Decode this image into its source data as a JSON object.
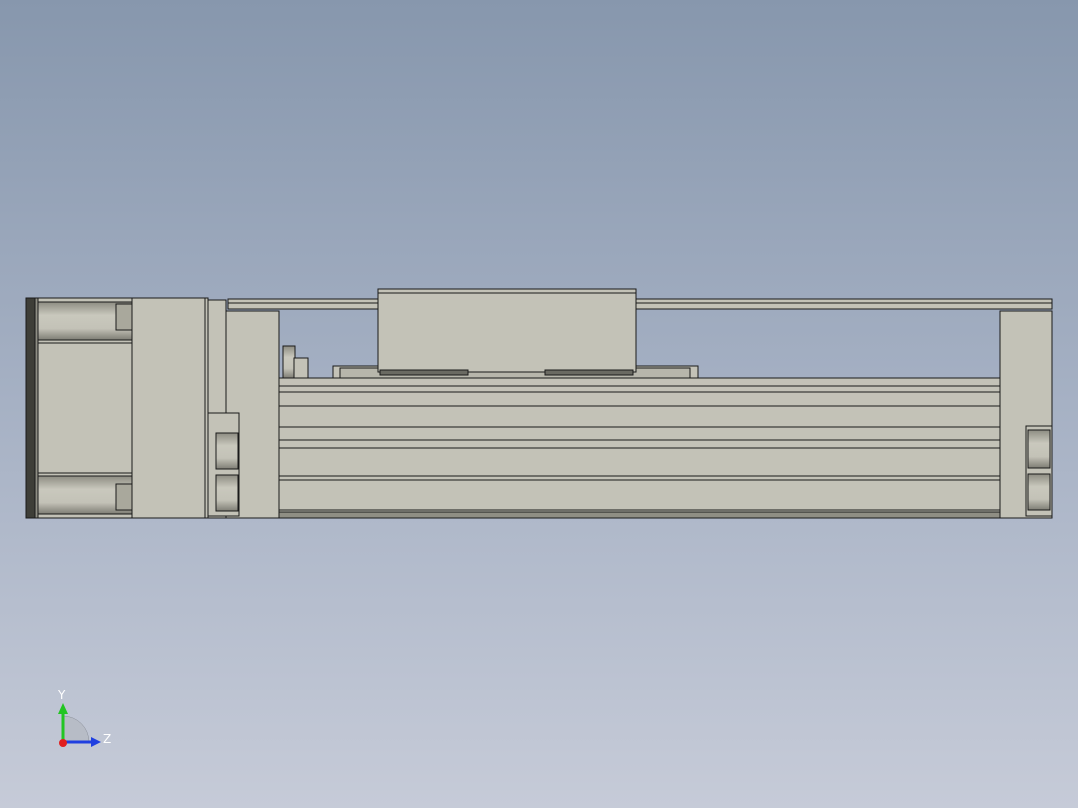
{
  "triad": {
    "y_label": "Y",
    "z_label": "Z",
    "colors": {
      "y_axis": "#22c522",
      "z_axis": "#1f3fe0",
      "x_origin": "#e01f1f"
    }
  },
  "colors": {
    "background_top": "#8797ad",
    "background_bottom": "#c6cbd8",
    "part_fill": "#c3c2b7",
    "part_shade": "#a9a89c",
    "part_dark": "#4a4a44",
    "edge": "#1a1a1a"
  }
}
